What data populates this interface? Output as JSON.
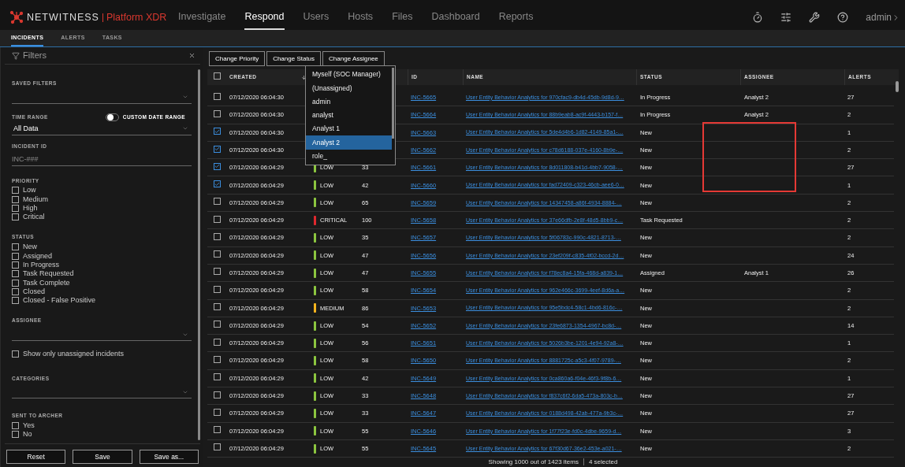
{
  "brand": {
    "name": "NETWITNESS",
    "product": "Platform XDR"
  },
  "nav": [
    {
      "label": "Investigate",
      "selected": false
    },
    {
      "label": "Respond",
      "selected": true
    },
    {
      "label": "Users",
      "selected": false
    },
    {
      "label": "Hosts",
      "selected": false
    },
    {
      "label": "Files",
      "selected": false
    },
    {
      "label": "Dashboard",
      "selected": false
    },
    {
      "label": "Reports",
      "selected": false
    }
  ],
  "user": "admin",
  "subtabs": [
    {
      "label": "INCIDENTS",
      "selected": true
    },
    {
      "label": "ALERTS",
      "selected": false
    },
    {
      "label": "TASKS",
      "selected": false
    }
  ],
  "filters": {
    "title": "Filters",
    "saved_filters": {
      "label": "SAVED FILTERS"
    },
    "time_range": {
      "label": "TIME RANGE",
      "toggle_label": "CUSTOM DATE RANGE",
      "on": false,
      "value": "All Data"
    },
    "incident_id": {
      "label": "INCIDENT ID",
      "placeholder": "INC-###"
    },
    "priority": {
      "label": "PRIORITY",
      "options": [
        {
          "label": "Low",
          "checked": false
        },
        {
          "label": "Medium",
          "checked": false
        },
        {
          "label": "High",
          "checked": false
        },
        {
          "label": "Critical",
          "checked": false
        }
      ]
    },
    "status": {
      "label": "STATUS",
      "options": [
        {
          "label": "New",
          "checked": false
        },
        {
          "label": "Assigned",
          "checked": false
        },
        {
          "label": "In Progress",
          "checked": false
        },
        {
          "label": "Task Requested",
          "checked": false
        },
        {
          "label": "Task Complete",
          "checked": false
        },
        {
          "label": "Closed",
          "checked": false
        },
        {
          "label": "Closed - False Positive",
          "checked": false
        }
      ]
    },
    "assignee": {
      "label": "ASSIGNEE",
      "unassigned_only": {
        "label": "Show only unassigned incidents",
        "checked": false
      }
    },
    "categories": {
      "label": "CATEGORIES"
    },
    "sent_to_archer": {
      "label": "SENT TO ARCHER",
      "options": [
        {
          "label": "Yes",
          "checked": false
        },
        {
          "label": "No",
          "checked": false
        }
      ]
    },
    "buttons": [
      "Reset",
      "Save",
      "Save as..."
    ]
  },
  "toolbar": [
    "Change Priority",
    "Change Status",
    "Change Assignee"
  ],
  "assignee_menu": [
    {
      "label": "Myself (SOC Manager)",
      "selected": false
    },
    {
      "label": "(Unassigned)",
      "selected": false
    },
    {
      "label": "admin",
      "selected": false
    },
    {
      "label": "analyst",
      "selected": false
    },
    {
      "label": "Analyst 1",
      "selected": false
    },
    {
      "label": "Analyst 2",
      "selected": true
    },
    {
      "label": "role_",
      "selected": false
    }
  ],
  "table": {
    "columns": [
      {
        "label": "CREATED",
        "sorted": true
      },
      {
        "label": "ID",
        "sorted": false
      },
      {
        "label": "NAME",
        "sorted": false
      },
      {
        "label": "STATUS",
        "sorted": false
      },
      {
        "label": "ASSIGNEE",
        "sorted": false
      },
      {
        "label": "ALERTS",
        "sorted": false
      }
    ],
    "all_checked": false,
    "rows": [
      {
        "checked": false,
        "created": "07/12/2020 06:04:30",
        "id": "INC-5665",
        "name": "User Entity Behavior Analytics for 970cfac9-db4d-45db-9d8d-9…",
        "status": "In Progress",
        "assignee": "Analyst 2",
        "alerts": "27"
      },
      {
        "checked": false,
        "created": "07/12/2020 06:04:30",
        "id": "INC-5664",
        "name": "User Entity Behavior Analytics for 88b9eab8-ac9f-4443-b157-f…",
        "status": "In Progress",
        "assignee": "Analyst 2",
        "alerts": "2"
      },
      {
        "checked": true,
        "created": "07/12/2020 06:04:30",
        "id": "INC-5663",
        "name": "User Entity Behavior Analytics for 5de4d4b6-1d82-4149-85a1-…",
        "status": "New",
        "alerts": "1"
      },
      {
        "checked": true,
        "created": "07/12/2020 06:04:30",
        "id": "INC-5662",
        "name": "User Entity Behavior Analytics for c78d6188-037e-4160-8b9e-…",
        "status": "New",
        "alerts": "2"
      },
      {
        "checked": true,
        "created": "07/12/2020 06:04:29",
        "priority": "LOW",
        "color": "#8cc63f",
        "score": "33",
        "id": "INC-5661",
        "name": "User Entity Behavior Analytics for 8d011808-b41d-4bb7-9058-…",
        "status": "New",
        "alerts": "27"
      },
      {
        "checked": true,
        "created": "07/12/2020 06:04:29",
        "priority": "LOW",
        "color": "#8cc63f",
        "score": "42",
        "id": "INC-5660",
        "name": "User Entity Behavior Analytics for fad72409-c323-46cb-aee6-0…",
        "status": "New",
        "alerts": "1"
      },
      {
        "checked": false,
        "created": "07/12/2020 06:04:29",
        "priority": "LOW",
        "color": "#8cc63f",
        "score": "65",
        "id": "INC-5659",
        "name": "User Entity Behavior Analytics for 14347458-a86f-4934-8884-…",
        "status": "New",
        "alerts": "2"
      },
      {
        "checked": false,
        "created": "07/12/2020 06:04:29",
        "priority": "CRITICAL",
        "color": "#e0282e",
        "score": "100",
        "id": "INC-5658",
        "name": "User Entity Behavior Analytics for 37e66dfb-2e8f-48d5-8bb9-c…",
        "status": "Task Requested",
        "alerts": "2"
      },
      {
        "checked": false,
        "created": "07/12/2020 06:04:29",
        "priority": "LOW",
        "color": "#8cc63f",
        "score": "35",
        "id": "INC-5657",
        "name": "User Entity Behavior Analytics for 5f06783c-990c-4821-8713-…",
        "status": "New",
        "alerts": "2"
      },
      {
        "checked": false,
        "created": "07/12/2020 06:04:29",
        "priority": "LOW",
        "color": "#8cc63f",
        "score": "47",
        "id": "INC-5656",
        "name": "User Entity Behavior Analytics for 23ef209f-c835-4f02-bccd-2d…",
        "status": "New",
        "alerts": "24"
      },
      {
        "checked": false,
        "created": "07/12/2020 06:04:29",
        "priority": "LOW",
        "color": "#8cc63f",
        "score": "47",
        "id": "INC-5655",
        "name": "User Entity Behavior Analytics for f78ec8a4-15fa-468d-a839-1…",
        "status": "Assigned",
        "assignee": "Analyst 1",
        "alerts": "26"
      },
      {
        "checked": false,
        "created": "07/12/2020 06:04:29",
        "priority": "LOW",
        "color": "#8cc63f",
        "score": "58",
        "id": "INC-5654",
        "name": "User Entity Behavior Analytics for 962e466c-3699-4eef-8d6a-a…",
        "status": "New",
        "alerts": "2"
      },
      {
        "checked": false,
        "created": "07/12/2020 06:04:29",
        "priority": "MEDIUM",
        "color": "#f5b41e",
        "score": "86",
        "id": "INC-5653",
        "name": "User Entity Behavior Analytics for 95e5bdc4-58c1-4bd6-816c-…",
        "status": "New",
        "alerts": "2"
      },
      {
        "checked": false,
        "created": "07/12/2020 06:04:29",
        "priority": "LOW",
        "color": "#8cc63f",
        "score": "54",
        "id": "INC-5652",
        "name": "User Entity Behavior Analytics for 23fe6873-1354-4967-bc8d-…",
        "status": "New",
        "alerts": "14"
      },
      {
        "checked": false,
        "created": "07/12/2020 06:04:29",
        "priority": "LOW",
        "color": "#8cc63f",
        "score": "56",
        "id": "INC-5651",
        "name": "User Entity Behavior Analytics for 5026b3be-1201-4e94-92a8-…",
        "status": "New",
        "alerts": "1"
      },
      {
        "checked": false,
        "created": "07/12/2020 06:04:29",
        "priority": "LOW",
        "color": "#8cc63f",
        "score": "58",
        "id": "INC-5650",
        "name": "User Entity Behavior Analytics for 8881725c-a5c3-4f07-9789-…",
        "status": "New",
        "alerts": "2"
      },
      {
        "checked": false,
        "created": "07/12/2020 06:04:29",
        "priority": "LOW",
        "color": "#8cc63f",
        "score": "42",
        "id": "INC-5649",
        "name": "User Entity Behavior Analytics for 0ca860a6-f04e-46f3-9f8b-6…",
        "status": "New",
        "alerts": "1"
      },
      {
        "checked": false,
        "created": "07/12/2020 06:04:29",
        "priority": "LOW",
        "color": "#8cc63f",
        "score": "33",
        "id": "INC-5648",
        "name": "User Entity Behavior Analytics for f837c6f2-6da5-473a-803c-b…",
        "status": "New",
        "alerts": "27"
      },
      {
        "checked": false,
        "created": "07/12/2020 06:04:29",
        "priority": "LOW",
        "color": "#8cc63f",
        "score": "33",
        "id": "INC-5647",
        "name": "User Entity Behavior Analytics for 0188d498-42ab-477a-9b3c-…",
        "status": "New",
        "alerts": "27"
      },
      {
        "checked": false,
        "created": "07/12/2020 06:04:29",
        "priority": "LOW",
        "color": "#8cc63f",
        "score": "55",
        "id": "INC-5646",
        "name": "User Entity Behavior Analytics for 1f77f23e-fd0c-4dbe-9659-d…",
        "status": "New",
        "alerts": "3"
      },
      {
        "checked": false,
        "created": "07/12/2020 06:04:29",
        "priority": "LOW",
        "color": "#8cc63f",
        "score": "55",
        "id": "INC-5645",
        "name": "User Entity Behavior Analytics for 67f30d67-36e2-453e-a021-…",
        "status": "New",
        "alerts": "2"
      }
    ]
  },
  "footer": {
    "count": "Showing 1000 out of 1423 items",
    "selected": "4 selected"
  }
}
